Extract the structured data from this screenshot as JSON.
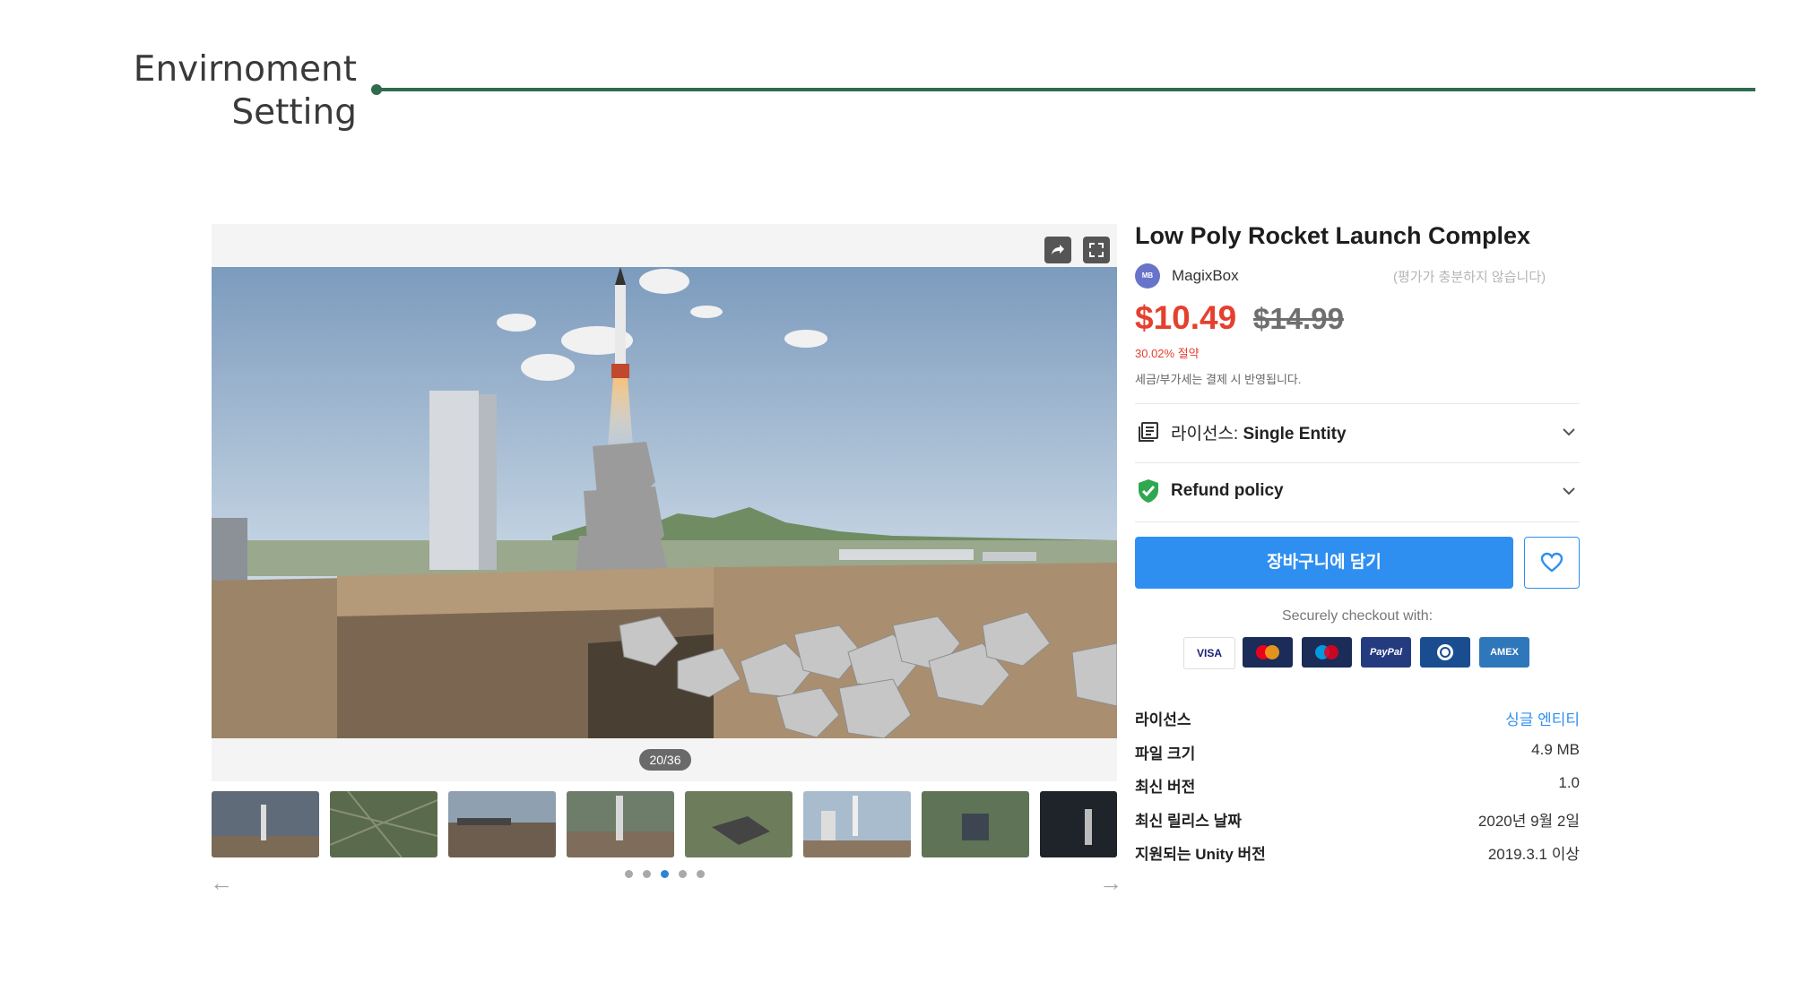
{
  "slide": {
    "title_line1": "Envirnoment",
    "title_line2": "Setting"
  },
  "gallery": {
    "counter": "20/36",
    "share_icon": "share-icon",
    "fullscreen_icon": "fullscreen-icon",
    "thumbnail_count_visible": 8,
    "pagination_dots": 5,
    "active_dot": 3,
    "prev_arrow": "←",
    "next_arrow": "→"
  },
  "product": {
    "title": "Low Poly Rocket Launch Complex",
    "publisher_initials": "MB",
    "publisher": "MagixBox",
    "rating_note": "(평가가 충분하지 않습니다)",
    "price": "$10.49",
    "original_price": "$14.99",
    "savings": "30.02% 절약",
    "tax_note": "세금/부가세는 결제 시 반영됩니다.",
    "license_label_prefix": "라이선스: ",
    "license_label_value": "Single Entity",
    "refund_label": "Refund policy",
    "cart_button": "장바구니에 담기",
    "checkout_note": "Securely checkout with:",
    "payment_methods": [
      "VISA",
      "MC",
      "Maestro",
      "PayPal",
      "Diners",
      "AMEX"
    ]
  },
  "specs": [
    {
      "label": "라이선스",
      "value": "싱글 엔티티"
    },
    {
      "label": "파일 크기",
      "value": "4.9 MB"
    },
    {
      "label": "최신 버전",
      "value": "1.0"
    },
    {
      "label": "최신 릴리스 날짜",
      "value": "2020년 9월 2일"
    },
    {
      "label": "지원되는 Unity 버전",
      "value": "2019.3.1 이상"
    }
  ],
  "colors": {
    "accent": "#2f8ff0",
    "price_red": "#e5402f",
    "header_line": "#2f6b4f",
    "refund_green": "#2fa84f"
  }
}
